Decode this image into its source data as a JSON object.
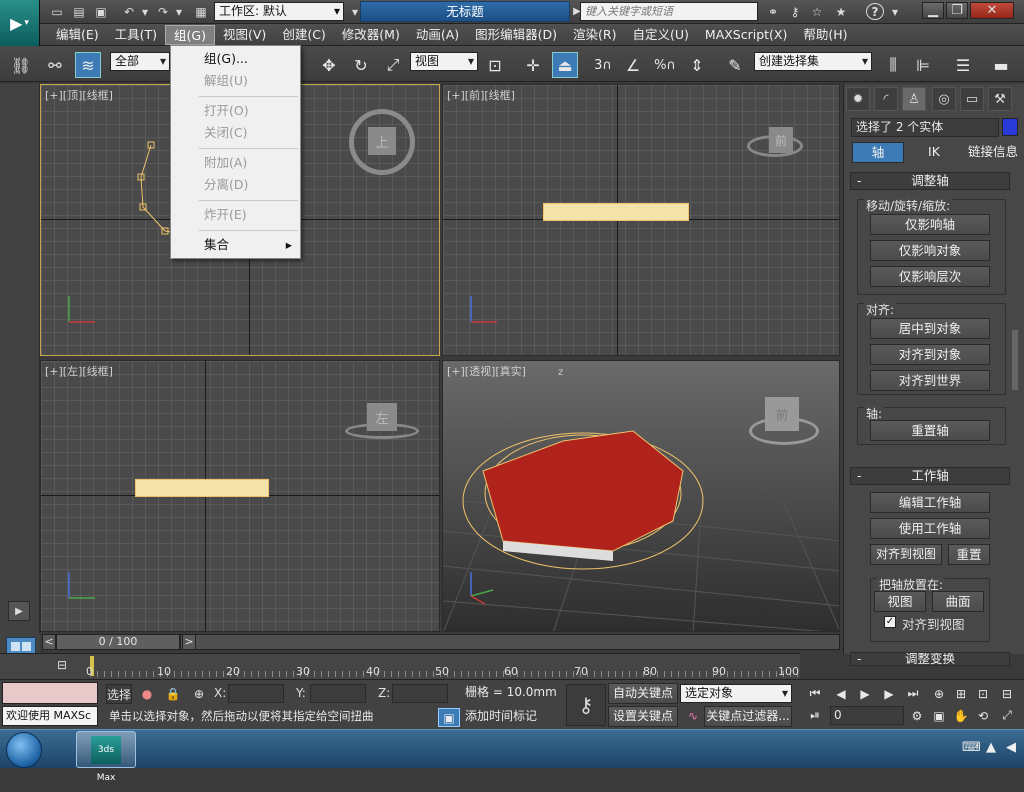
{
  "app": {
    "title": "无标题",
    "workspace": "工作区: 默认",
    "search_placeholder": "键入关键字或短语",
    "logo": "3ds Max"
  },
  "menu": {
    "items": [
      "编辑(E)",
      "工具(T)",
      "组(G)",
      "视图(V)",
      "创建(C)",
      "修改器(M)",
      "动画(A)",
      "图形编辑器(D)",
      "渲染(R)",
      "自定义(U)",
      "MAXScript(X)",
      "帮助(H)"
    ],
    "active": "组(G)"
  },
  "group_menu": {
    "items": [
      {
        "label": "组(G)...",
        "enabled": true
      },
      {
        "label": "解组(U)",
        "enabled": false
      },
      {
        "label": "打开(O)",
        "enabled": false
      },
      {
        "label": "关闭(C)",
        "enabled": false
      },
      {
        "label": "附加(A)",
        "enabled": false
      },
      {
        "label": "分离(D)",
        "enabled": false
      },
      {
        "label": "炸开(E)",
        "enabled": false
      },
      {
        "label": "集合",
        "enabled": true,
        "submenu": "▸"
      }
    ]
  },
  "toolbar": {
    "filter": "全部",
    "ref_coord": "视图",
    "selection_set": "创建选择集",
    "snap_labels": [
      "3",
      "%"
    ]
  },
  "viewports": {
    "top": {
      "label": "[+][顶][线框]",
      "cube": "上"
    },
    "front": {
      "label": "[+][前][线框]",
      "cube": "前"
    },
    "left": {
      "label": "[+][左][线框]",
      "cube": "左"
    },
    "persp": {
      "label": "[+][透视][真实]",
      "cube": "前"
    },
    "axis_z": "z",
    "axis_x": "x"
  },
  "panel": {
    "selection_info": "选择了 2 个实体",
    "tabs": [
      "轴",
      "IK",
      "链接信息"
    ],
    "rollout_adjust": "调整轴",
    "move_rotate_scale": "移动/旋转/缩放:",
    "btn_affect_pivot": "仅影响轴",
    "btn_affect_object": "仅影响对象",
    "btn_affect_hierarchy": "仅影响层次",
    "align_title": "对齐:",
    "btn_center": "居中到对象",
    "btn_align_obj": "对齐到对象",
    "btn_align_world": "对齐到世界",
    "pivot_title": "轴:",
    "btn_reset_pivot": "重置轴",
    "rollout_working": "工作轴",
    "btn_edit_wp": "编辑工作轴",
    "btn_use_wp": "使用工作轴",
    "btn_align_view": "对齐到视图",
    "btn_reset": "重置",
    "place_title": "把轴放置在:",
    "btn_view": "视图",
    "btn_surface": "曲面",
    "chk_align_view": "对齐到视图",
    "rollout_transform": "调整变换",
    "minus": "-"
  },
  "timeline": {
    "frame": "0 / 100",
    "prev": "<",
    "next": ">",
    "ticks": [
      "0",
      "10",
      "20",
      "30",
      "40",
      "50",
      "60",
      "70",
      "80",
      "90",
      "100"
    ]
  },
  "status": {
    "welcome": "欢迎使用 MAXSc",
    "select_label": "选择",
    "x_label": "X:",
    "y_label": "Y:",
    "z_label": "Z:",
    "grid": "栅格 = 10.0mm",
    "auto_key": "自动关键点",
    "set_key": "设置关键点",
    "key_mode": "选定对象",
    "key_filter": "关键点过滤器...",
    "add_time_tag": "添加时间标记",
    "prompt": "单击以选择对象，然后拖动以便将其指定给空间扭曲",
    "frame_value": "0"
  },
  "colors": {
    "accent": "#3c7bb5",
    "selected_border": "#c8a64b",
    "wire": "#f0c36a",
    "red": "#b0231d"
  }
}
